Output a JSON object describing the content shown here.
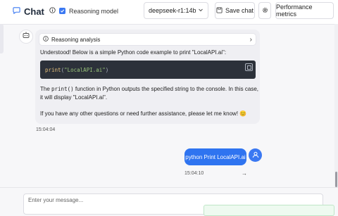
{
  "header": {
    "title": "Chat",
    "reasoning_label": "Reasoning model",
    "reasoning_checked": true,
    "model": "deepseek-r1:14b",
    "save_label": "Save chat",
    "perf_label": "Performance metrics"
  },
  "assistant_message": {
    "reasoning_title": "Reasoning analysis",
    "intro": "Understood! Below is a simple Python code example to print \"LocalAPI.ai\":",
    "code": {
      "fn": "print",
      "open": "(",
      "str": "\"LocalAPI.ai\"",
      "close": ")"
    },
    "explain_pre": "The ",
    "explain_code": "print()",
    "explain_post": " function in Python outputs the specified string to the console. In this case, it will display \"LocalAPI.ai\".",
    "closing": "If you have any other questions or need further assistance, please let me know! 😊",
    "time": "15:04:04"
  },
  "user_message": {
    "text": "python Print LocalAPI.ai",
    "time": "15:04:10"
  },
  "composer": {
    "placeholder": "Enter your message..."
  },
  "colors": {
    "accent": "#2f74f0",
    "code_bg": "#2c313a"
  }
}
